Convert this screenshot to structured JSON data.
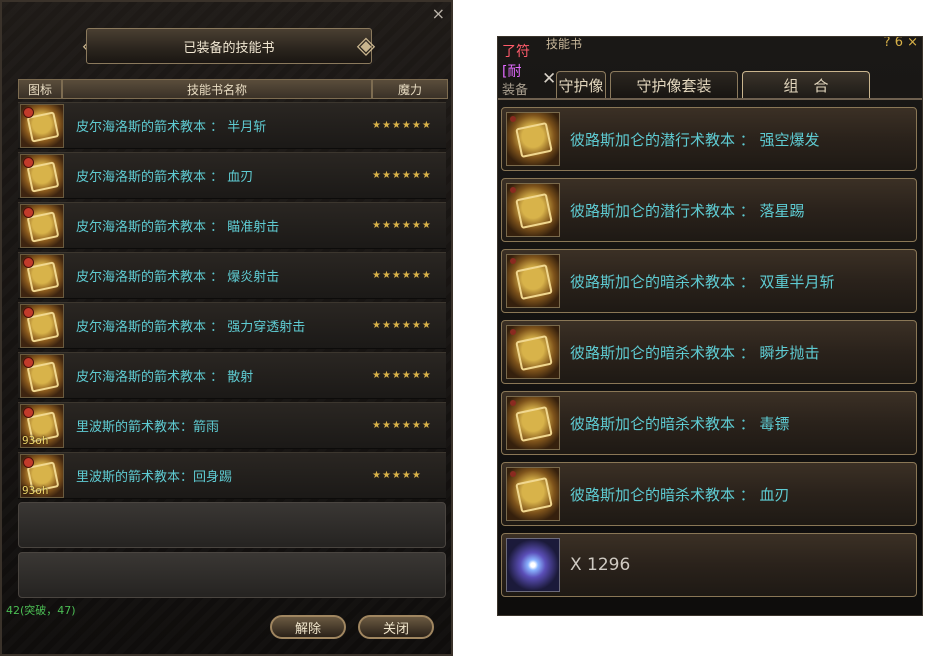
{
  "left": {
    "title": "已装备的技能书",
    "columns": {
      "icon": "图标",
      "name": "技能书名称",
      "mana": "魔力"
    },
    "rows": [
      {
        "name": "皮尔海洛斯的箭术教本 ： 半月斩",
        "stars": "★★★★★★",
        "timer": ""
      },
      {
        "name": "皮尔海洛斯的箭术教本 ： 血刃",
        "stars": "★★★★★★",
        "timer": ""
      },
      {
        "name": "皮尔海洛斯的箭术教本 ： 瞄准射击",
        "stars": "★★★★★★",
        "timer": ""
      },
      {
        "name": "皮尔海洛斯的箭术教本 ： 爆炎射击",
        "stars": "★★★★★★",
        "timer": ""
      },
      {
        "name": "皮尔海洛斯的箭术教本 ： 强力穿透射击",
        "stars": "★★★★★★",
        "timer": ""
      },
      {
        "name": "皮尔海洛斯的箭术教本 ： 散射",
        "stars": "★★★★★★",
        "timer": ""
      },
      {
        "name": "里波斯的箭术教本：箭雨",
        "stars": "★★★★★★",
        "timer": "93oh"
      },
      {
        "name": "里波斯的箭术教本：回身踢",
        "stars": "★★★★★",
        "timer": "93oh"
      }
    ],
    "buttons": {
      "remove": "解除",
      "close": "关闭"
    },
    "overlap_text": "42(突破，47)"
  },
  "right": {
    "title": "技能书",
    "title_icons": "? 6 ×",
    "overlap": {
      "red": "了符",
      "purple": "[耐",
      "grey": "装备"
    },
    "tabs": [
      "守护像",
      "守护像套装",
      "组　合"
    ],
    "rows": [
      {
        "name": "彼路斯加仑的潜行术教本 ： 强空爆发"
      },
      {
        "name": "彼路斯加仑的潜行术教本 ： 落星踢"
      },
      {
        "name": "彼路斯加仑的暗杀术教本 ： 双重半月斩"
      },
      {
        "name": "彼路斯加仑的暗杀术教本 ： 瞬步抛击"
      },
      {
        "name": "彼路斯加仑的暗杀术教本 ： 毒镖"
      },
      {
        "name": "彼路斯加仑的暗杀术教本 ： 血刃"
      }
    ],
    "gem_quantity": "X 1296"
  }
}
